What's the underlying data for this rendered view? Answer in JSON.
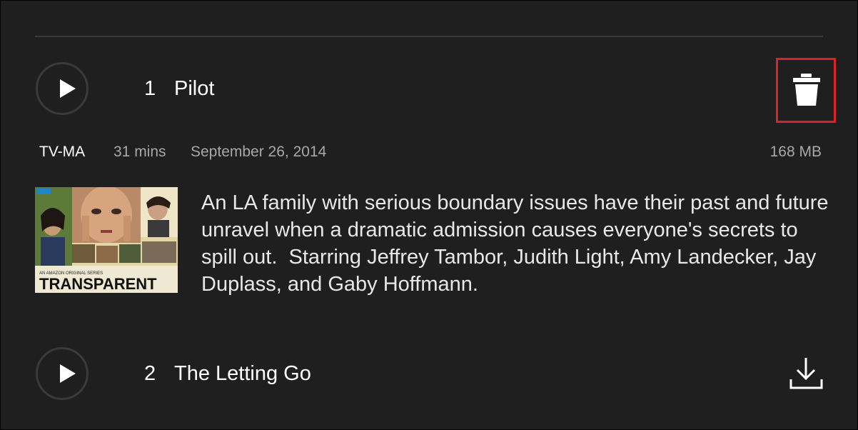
{
  "episodes": [
    {
      "number": "1",
      "title": "Pilot",
      "action_icon": "trash-icon",
      "play_icon": "play-icon"
    },
    {
      "number": "2",
      "title": "The Letting Go",
      "action_icon": "download-icon",
      "play_icon": "play-icon"
    }
  ],
  "details": {
    "rating": "TV-MA",
    "duration": "31 mins",
    "date": "September 26, 2014",
    "size": "168 MB",
    "description": "An LA family with serious boundary issues have their past and future unravel when a dramatic admission causes everyone's secrets to spill out.  Starring Jeffrey Tambor, Judith Light, Amy Landecker, Jay Duplass, and Gaby Hoffmann."
  },
  "thumbnail": {
    "badge": "prime",
    "subtitle": "AN AMAZON ORIGINAL SERIES",
    "title": "TRANSPARENT"
  },
  "colors": {
    "background": "#1f1f1f",
    "highlight": "#d8232a",
    "text_primary": "#ffffff",
    "text_secondary": "#a8a8a8"
  }
}
